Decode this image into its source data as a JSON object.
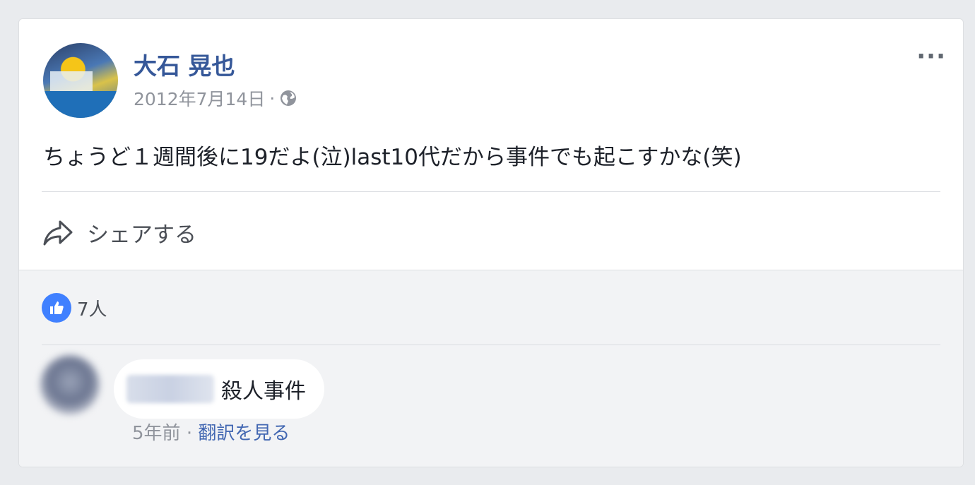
{
  "post": {
    "author": "大石 晃也",
    "date": "2012年7月14日",
    "separator": "·",
    "privacy_icon": "globe-icon",
    "more_icon": "···",
    "text": "ちょうど１週間後に19だよ(泣)last10代だから事件でも起こすかな(笑)",
    "share_label": "シェアする"
  },
  "reactions": {
    "icon": "thumbs-up-icon",
    "count_label": "7人"
  },
  "comment": {
    "author_blurred": true,
    "text": "殺人事件",
    "time": "5年前",
    "separator": "·",
    "translate_link": "翻訳を見る"
  },
  "colors": {
    "author_link": "#365899",
    "meta_gray": "#90949c",
    "like_blue": "#4080ff",
    "link_blue": "#4267b2",
    "background": "#e9ebee"
  }
}
